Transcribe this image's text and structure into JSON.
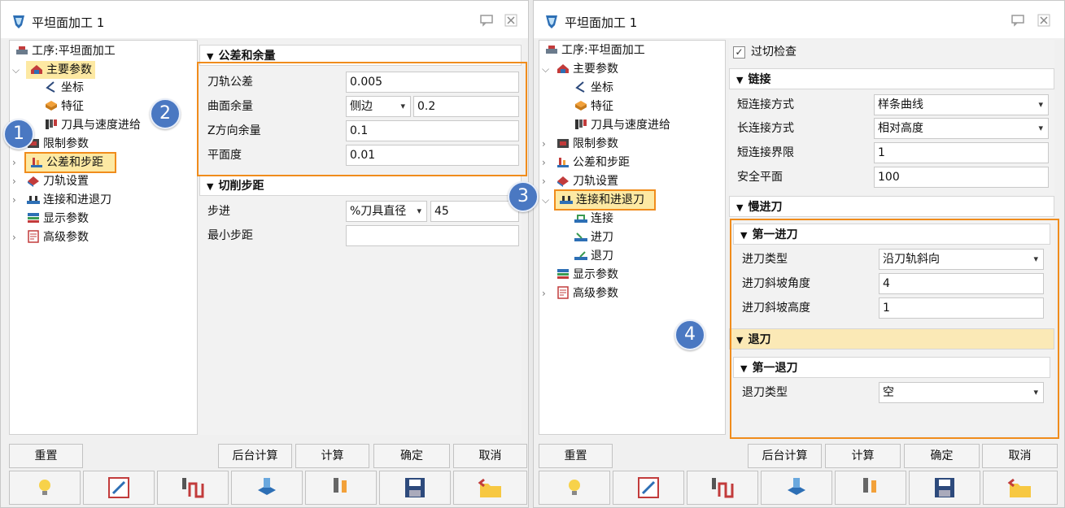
{
  "left": {
    "title": "平坦面加工 1",
    "tree": [
      "工序:平坦面加工",
      "主要参数",
      "坐标",
      "特征",
      "刀具与速度进给",
      "限制参数",
      "公差和步距",
      "刀轨设置",
      "连接和进退刀",
      "显示参数",
      "高级参数"
    ],
    "tol_section": "公差和余量",
    "tol_rows": {
      "tool_tol_label": "刀轨公差",
      "tool_tol": "0.005",
      "surface_label": "曲面余量",
      "surface_mode": "侧边",
      "surface_val": "0.2",
      "z_label": "Z方向余量",
      "z_val": "0.1",
      "flat_label": "平面度",
      "flat_val": "0.01"
    },
    "step_section": "切削步距",
    "step_rows": {
      "step_label": "步进",
      "step_mode": "%刀具直径",
      "step_val": "45",
      "min_label": "最小步距",
      "min_val": ""
    }
  },
  "right": {
    "title": "平坦面加工 1",
    "tree": [
      "工序:平坦面加工",
      "主要参数",
      "坐标",
      "特征",
      "刀具与速度进给",
      "限制参数",
      "公差和步距",
      "刀轨设置",
      "连接和进退刀",
      "连接",
      "进刀",
      "退刀",
      "显示参数",
      "高级参数"
    ],
    "gouge_check": "过切检查",
    "link_section": "链接",
    "link_rows": {
      "short_label": "短连接方式",
      "short_val": "样条曲线",
      "long_label": "长连接方式",
      "long_val": "相对高度",
      "limit_label": "短连接界限",
      "limit_val": "1",
      "safe_label": "安全平面",
      "safe_val": "100"
    },
    "slow_section": "慢进刀",
    "first_in": "第一进刀",
    "in_rows": {
      "type_label": "进刀类型",
      "type_val": "沿刀轨斜向",
      "angle_label": "进刀斜坡角度",
      "angle_val": "4",
      "height_label": "进刀斜坡高度",
      "height_val": "1"
    },
    "retract_section": "退刀",
    "first_out": "第一退刀",
    "out_rows": {
      "type_label": "退刀类型",
      "type_val": "空"
    }
  },
  "buttons": {
    "reset": "重置",
    "bg_calc": "后台计算",
    "calc": "计算",
    "ok": "确定",
    "cancel": "取消"
  },
  "badges": [
    "1",
    "2",
    "3",
    "4"
  ],
  "colors": {
    "accent_orange": "#f08c1c",
    "badge_blue": "#4a78c2",
    "selection": "#fde9a3"
  }
}
